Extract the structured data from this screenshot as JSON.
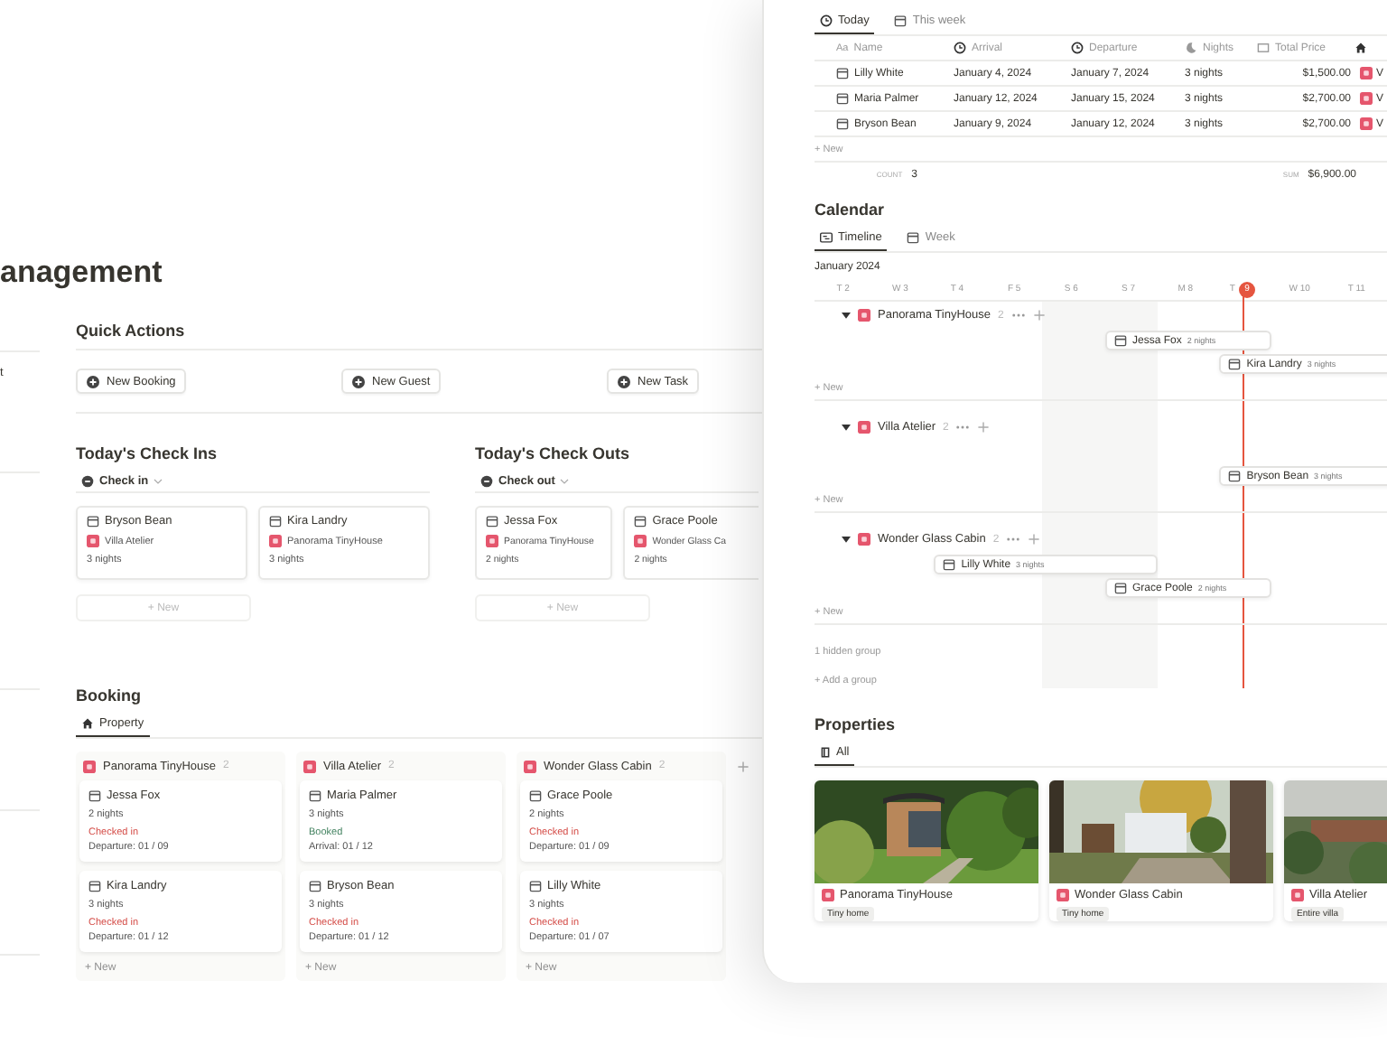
{
  "page": {
    "title": "anagement",
    "side_items": [
      {
        "label": "t"
      }
    ],
    "quick_actions": {
      "title": "Quick Actions",
      "buttons": [
        "New Booking",
        "New Guest",
        "New Task"
      ]
    },
    "check_ins": {
      "title": "Today's Check Ins",
      "view": "Check in",
      "new": "+ New",
      "cards": [
        {
          "name": "Bryson Bean",
          "property": "Villa Atelier",
          "nights": "3 nights"
        },
        {
          "name": "Kira Landry",
          "property": "Panorama TinyHouse",
          "nights": "3 nights"
        }
      ]
    },
    "check_outs": {
      "title": "Today's Check Outs",
      "view": "Check out",
      "new": "+ New",
      "cards": [
        {
          "name": "Jessa Fox",
          "property": "Panorama TinyHouse",
          "nights": "2 nights"
        },
        {
          "name": "Grace Poole",
          "property": "Wonder Glass Ca",
          "nights": "2 nights"
        }
      ]
    },
    "booking": {
      "title": "Booking",
      "tabs": [
        {
          "label": "Property",
          "selected": true
        }
      ],
      "columns": [
        {
          "name": "Panorama TinyHouse",
          "count": "2",
          "new": "+ New",
          "cards": [
            {
              "name": "Jessa Fox",
              "nights": "2 nights",
              "status": "Checked in",
              "kind": "checked_in",
              "date": "Departure: 01 / 09"
            },
            {
              "name": "Kira Landry",
              "nights": "3 nights",
              "status": "Checked in",
              "kind": "checked_in",
              "date": "Departure: 01 / 12"
            }
          ]
        },
        {
          "name": "Villa Atelier",
          "count": "2",
          "new": "+ New",
          "cards": [
            {
              "name": "Maria Palmer",
              "nights": "3 nights",
              "status": "Booked",
              "kind": "booked",
              "date": "Arrival: 01 / 12"
            },
            {
              "name": "Bryson Bean",
              "nights": "3 nights",
              "status": "Checked in",
              "kind": "checked_in",
              "date": "Departure: 01 / 12"
            }
          ]
        },
        {
          "name": "Wonder Glass Cabin",
          "count": "2",
          "new": "+ New",
          "cards": [
            {
              "name": "Grace Poole",
              "nights": "2 nights",
              "status": "Checked in",
              "kind": "checked_in",
              "date": "Departure: 01 / 09"
            },
            {
              "name": "Lilly White",
              "nights": "3 nights",
              "status": "Checked in",
              "kind": "checked_in",
              "date": "Departure: 01 / 07"
            }
          ]
        }
      ]
    }
  },
  "panel": {
    "latest": {
      "tabs": [
        {
          "label": "Today",
          "selected": true
        },
        {
          "label": "This week",
          "selected": false
        }
      ],
      "columns": [
        {
          "label": "Name",
          "prefix": "Aa"
        },
        {
          "label": "Arrival"
        },
        {
          "label": "Departure"
        },
        {
          "label": "Nights"
        },
        {
          "label": "Total Price"
        }
      ],
      "rows": [
        {
          "name": "Lilly White",
          "arrival": "January 4, 2024",
          "departure": "January 7, 2024",
          "nights": "3 nights",
          "total": "$1,500.00",
          "column_6": "V"
        },
        {
          "name": "Maria Palmer",
          "arrival": "January 12, 2024",
          "departure": "January 15, 2024",
          "nights": "3 nights",
          "total": "$2,700.00",
          "column_6": "V"
        },
        {
          "name": "Bryson Bean",
          "arrival": "January 9, 2024",
          "departure": "January 12, 2024",
          "nights": "3 nights",
          "total": "$2,700.00",
          "column_6": "V"
        }
      ],
      "new": "+ New",
      "count_label": "COUNT",
      "count": "3",
      "sum_label": "SUM",
      "sum": "$6,900.00"
    },
    "calendar": {
      "title": "Calendar",
      "tabs": [
        {
          "label": "Timeline",
          "selected": true
        },
        {
          "label": "Week",
          "selected": false
        }
      ],
      "month": "January 2024",
      "days": [
        {
          "weekday": "T",
          "date": "2",
          "weekend": false,
          "today": false
        },
        {
          "weekday": "W",
          "date": "3",
          "weekend": false,
          "today": false
        },
        {
          "weekday": "T",
          "date": "4",
          "weekend": false,
          "today": false
        },
        {
          "weekday": "F",
          "date": "5",
          "weekend": false,
          "today": false
        },
        {
          "weekday": "S",
          "date": "6",
          "weekend": true,
          "today": false
        },
        {
          "weekday": "S",
          "date": "7",
          "weekend": true,
          "today": false
        },
        {
          "weekday": "M",
          "date": "8",
          "weekend": false,
          "today": false
        },
        {
          "weekday": "T",
          "date": "9",
          "weekend": false,
          "today": true
        },
        {
          "weekday": "W",
          "date": "10",
          "weekend": false,
          "today": false
        },
        {
          "weekday": "T",
          "date": "11",
          "weekend": false,
          "today": false
        }
      ],
      "groups": [
        {
          "name": "Panorama TinyHouse",
          "count": "2",
          "expanded": true,
          "new": "+ New",
          "bars": [
            {
              "name": "Jessa Fox",
              "nights": "2 nights"
            },
            {
              "name": "Kira Landry",
              "nights": "3 nights"
            }
          ]
        },
        {
          "name": "Villa Atelier",
          "count": "2",
          "expanded": true,
          "new": "+ New",
          "bars": [
            {
              "name": "Bryson Bean",
              "nights": "3 nights"
            }
          ]
        },
        {
          "name": "Wonder Glass Cabin",
          "count": "2",
          "expanded": true,
          "new": "+ New",
          "bars": [
            {
              "name": "Lilly White",
              "nights": "3 nights"
            },
            {
              "name": "Grace Poole",
              "nights": "2 nights"
            }
          ]
        }
      ],
      "hidden": "1 hidden group",
      "add": "+ Add a group"
    },
    "properties": {
      "title": "Properties",
      "tabs": [
        {
          "label": "All",
          "selected": true
        }
      ],
      "cards": [
        {
          "name": "Panorama TinyHouse",
          "tag": "Tiny home",
          "kind": "picture"
        },
        {
          "name": "Wonder Glass Cabin",
          "tag": "Tiny home",
          "kind": "picture"
        },
        {
          "name": "Villa Atelier",
          "tag": "Entire villa",
          "kind": "picture"
        }
      ]
    }
  }
}
